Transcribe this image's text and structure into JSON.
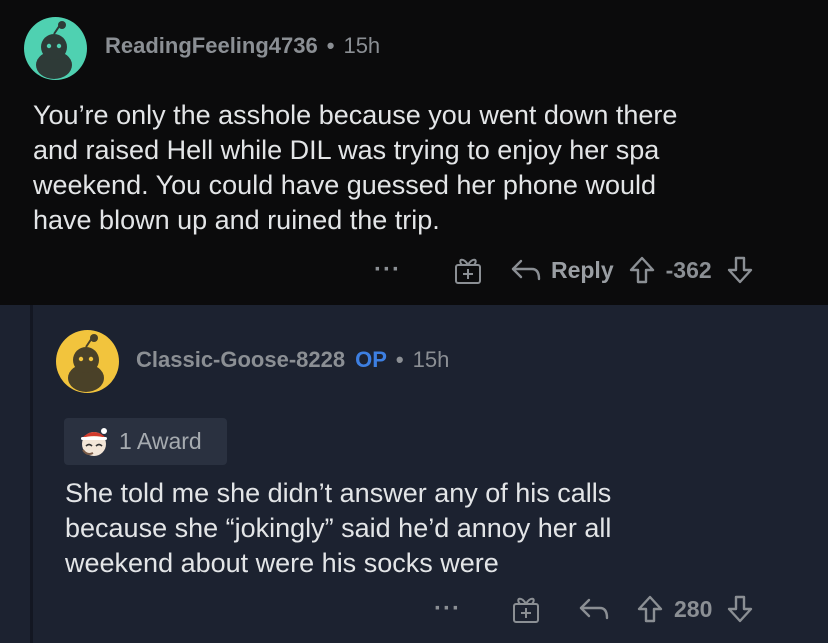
{
  "comments": [
    {
      "username": "ReadingFeeling4736",
      "time": "15h",
      "avatar_color": "#4fd1b1",
      "body_lines": [
        "You’re only the asshole because you went down there",
        "and raised Hell while DIL was trying to enjoy her spa",
        "weekend. You could have guessed her phone would",
        "have blown up and ruined the trip."
      ],
      "more": "···",
      "reply_label": "Reply",
      "score": "-362"
    },
    {
      "username": "Classic-Goose-8228",
      "op_badge": "OP",
      "time": "15h",
      "avatar_color": "#f2c43d",
      "award_label": "1 Award",
      "body_lines": [
        "She told me she didn’t answer any of his calls",
        "because she “jokingly” said he’d annoy her all",
        "weekend about were his socks were"
      ],
      "more": "···",
      "score": "280"
    }
  ],
  "separator": "•",
  "colors": {
    "background": "#0b0b0c",
    "reply_background": "#1c2230",
    "text_muted": "#8b8f94",
    "op_blue": "#3d7fe1"
  }
}
